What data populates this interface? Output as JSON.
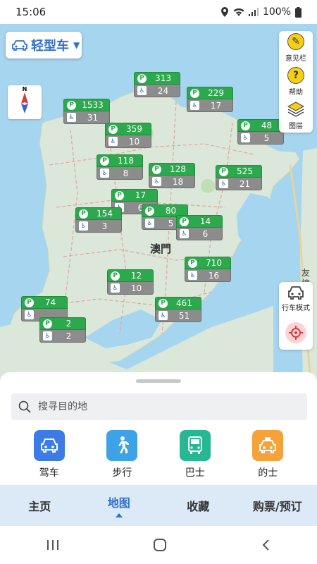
{
  "status_bar": {
    "time": "15:06",
    "battery": "100%"
  },
  "vehicle": {
    "label": "轻型车",
    "icon": "car-icon"
  },
  "compass": {
    "label": "N"
  },
  "tools": [
    {
      "name": "feedback",
      "label": "意见栏",
      "icon": "edit-icon"
    },
    {
      "name": "help",
      "label": "帮助",
      "icon": "help-icon"
    },
    {
      "name": "layers",
      "label": "图层",
      "icon": "layers-icon"
    }
  ],
  "drive_mode": {
    "label": "行车模式",
    "icon": "car-front-icon"
  },
  "locate": {
    "icon": "locate-icon"
  },
  "map_labels": {
    "city": "澳門",
    "bridge": "友誼大橋"
  },
  "parking": [
    {
      "id": "p1",
      "spaces": "313",
      "accessible": "24"
    },
    {
      "id": "p2",
      "spaces": "229",
      "accessible": "17"
    },
    {
      "id": "p3",
      "spaces": "1533",
      "accessible": "31"
    },
    {
      "id": "p4",
      "spaces": "359",
      "accessible": "10"
    },
    {
      "id": "p5",
      "spaces": "48",
      "accessible": "5"
    },
    {
      "id": "p6",
      "spaces": "118",
      "accessible": "8"
    },
    {
      "id": "p7",
      "spaces": "128",
      "accessible": "18"
    },
    {
      "id": "p8",
      "spaces": "525",
      "accessible": "21"
    },
    {
      "id": "p9",
      "spaces": "17",
      "accessible": "6"
    },
    {
      "id": "p10",
      "spaces": "154",
      "accessible": "3"
    },
    {
      "id": "p11",
      "spaces": "80",
      "accessible": "5"
    },
    {
      "id": "p12",
      "spaces": "14",
      "accessible": "6"
    },
    {
      "id": "p13",
      "spaces": "710",
      "accessible": "16"
    },
    {
      "id": "p14",
      "spaces": "12",
      "accessible": "10"
    },
    {
      "id": "p15",
      "spaces": "461",
      "accessible": "51"
    },
    {
      "id": "p16",
      "spaces": "74",
      "accessible": ""
    },
    {
      "id": "p17",
      "spaces": "2",
      "accessible": "2"
    }
  ],
  "search": {
    "placeholder": "搜寻目的地"
  },
  "modes": [
    {
      "label": "驾车",
      "icon": "car-icon",
      "color": "#3d7be6"
    },
    {
      "label": "步行",
      "icon": "walk-icon",
      "color": "#3da2e6"
    },
    {
      "label": "巴士",
      "icon": "bus-icon",
      "color": "#25b892"
    },
    {
      "label": "的士",
      "icon": "taxi-icon",
      "color": "#f5a23a"
    }
  ],
  "tabs": [
    {
      "label": "主页",
      "active": false
    },
    {
      "label": "地图",
      "active": true
    },
    {
      "label": "收藏",
      "active": false
    },
    {
      "label": "购票/预订",
      "active": false
    }
  ]
}
